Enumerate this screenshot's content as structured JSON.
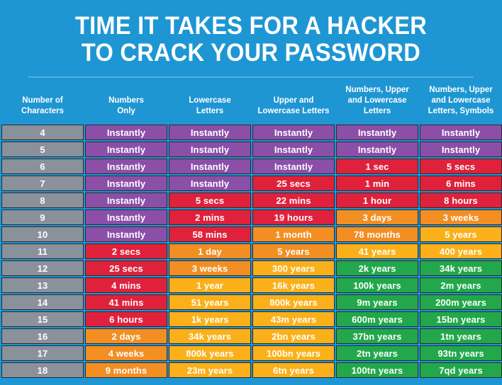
{
  "title": {
    "line1": "TIME IT TAKES FOR A HACKER",
    "line2": "TO CRACK YOUR PASSWORD"
  },
  "theme": {
    "background": "#1e96d3",
    "divider": "#53b0de",
    "text": "#ffffff",
    "gray": "#8a919b",
    "purple": "#8b4fa8",
    "red": "#e0213c",
    "orange": "#f28e22",
    "amber": "#fbb019",
    "green": "#22a84a",
    "cell_border": "#2b2b33"
  },
  "chart_data": {
    "type": "table",
    "title": "TIME IT TAKES FOR A HACKER TO CRACK YOUR PASSWORD",
    "xlabel": "",
    "ylabel": "",
    "columns": [
      "Number of Characters",
      "Numbers Only",
      "Lowercase Letters",
      "Upper and Lowercase Letters",
      "Numbers, Upper and Lowercase Letters",
      "Numbers, Upper and Lowercase Letters, Symbols"
    ],
    "column_lines": [
      [
        "Number of",
        "Characters"
      ],
      [
        "Numbers",
        "Only"
      ],
      [
        "Lowercase",
        "Letters"
      ],
      [
        "Upper and",
        "Lowercase Letters"
      ],
      [
        "Numbers, Upper",
        "and Lowercase",
        "Letters"
      ],
      [
        "Numbers, Upper",
        "and Lowercase",
        "Letters, Symbols"
      ]
    ],
    "rows": [
      {
        "chars": "4",
        "cells": [
          {
            "v": "Instantly",
            "color": "purple"
          },
          {
            "v": "Instantly",
            "color": "purple"
          },
          {
            "v": "Instantly",
            "color": "purple"
          },
          {
            "v": "Instantly",
            "color": "purple"
          },
          {
            "v": "Instantly",
            "color": "purple"
          }
        ]
      },
      {
        "chars": "5",
        "cells": [
          {
            "v": "Instantly",
            "color": "purple"
          },
          {
            "v": "Instantly",
            "color": "purple"
          },
          {
            "v": "Instantly",
            "color": "purple"
          },
          {
            "v": "Instantly",
            "color": "purple"
          },
          {
            "v": "Instantly",
            "color": "purple"
          }
        ]
      },
      {
        "chars": "6",
        "cells": [
          {
            "v": "Instantly",
            "color": "purple"
          },
          {
            "v": "Instantly",
            "color": "purple"
          },
          {
            "v": "Instantly",
            "color": "purple"
          },
          {
            "v": "1 sec",
            "color": "red"
          },
          {
            "v": "5 secs",
            "color": "red"
          }
        ]
      },
      {
        "chars": "7",
        "cells": [
          {
            "v": "Instantly",
            "color": "purple"
          },
          {
            "v": "Instantly",
            "color": "purple"
          },
          {
            "v": "25 secs",
            "color": "red"
          },
          {
            "v": "1 min",
            "color": "red"
          },
          {
            "v": "6 mins",
            "color": "red"
          }
        ]
      },
      {
        "chars": "8",
        "cells": [
          {
            "v": "Instantly",
            "color": "purple"
          },
          {
            "v": "5 secs",
            "color": "red"
          },
          {
            "v": "22 mins",
            "color": "red"
          },
          {
            "v": "1 hour",
            "color": "red"
          },
          {
            "v": "8 hours",
            "color": "red"
          }
        ]
      },
      {
        "chars": "9",
        "cells": [
          {
            "v": "Instantly",
            "color": "purple"
          },
          {
            "v": "2 mins",
            "color": "red"
          },
          {
            "v": "19 hours",
            "color": "red"
          },
          {
            "v": "3 days",
            "color": "orange"
          },
          {
            "v": "3 weeks",
            "color": "orange"
          }
        ]
      },
      {
        "chars": "10",
        "cells": [
          {
            "v": "Instantly",
            "color": "purple"
          },
          {
            "v": "58 mins",
            "color": "red"
          },
          {
            "v": "1 month",
            "color": "orange"
          },
          {
            "v": "78 months",
            "color": "orange"
          },
          {
            "v": "5 years",
            "color": "amber"
          }
        ]
      },
      {
        "chars": "11",
        "cells": [
          {
            "v": "2 secs",
            "color": "red"
          },
          {
            "v": "1 day",
            "color": "orange"
          },
          {
            "v": "5 years",
            "color": "orange"
          },
          {
            "v": "41 years",
            "color": "amber"
          },
          {
            "v": "400 years",
            "color": "amber"
          }
        ]
      },
      {
        "chars": "12",
        "cells": [
          {
            "v": "25 secs",
            "color": "red"
          },
          {
            "v": "3 weeks",
            "color": "orange"
          },
          {
            "v": "300 years",
            "color": "amber"
          },
          {
            "v": "2k years",
            "color": "green"
          },
          {
            "v": "34k years",
            "color": "green"
          }
        ]
      },
      {
        "chars": "13",
        "cells": [
          {
            "v": "4 mins",
            "color": "red"
          },
          {
            "v": "1 year",
            "color": "amber"
          },
          {
            "v": "16k years",
            "color": "amber"
          },
          {
            "v": "100k years",
            "color": "green"
          },
          {
            "v": "2m years",
            "color": "green"
          }
        ]
      },
      {
        "chars": "14",
        "cells": [
          {
            "v": "41 mins",
            "color": "red"
          },
          {
            "v": "51 years",
            "color": "amber"
          },
          {
            "v": "800k years",
            "color": "amber"
          },
          {
            "v": "9m years",
            "color": "green"
          },
          {
            "v": "200m years",
            "color": "green"
          }
        ]
      },
      {
        "chars": "15",
        "cells": [
          {
            "v": "6 hours",
            "color": "red"
          },
          {
            "v": "1k years",
            "color": "amber"
          },
          {
            "v": "43m years",
            "color": "amber"
          },
          {
            "v": "600m years",
            "color": "green"
          },
          {
            "v": "15bn years",
            "color": "green"
          }
        ]
      },
      {
        "chars": "16",
        "cells": [
          {
            "v": "2 days",
            "color": "orange"
          },
          {
            "v": "34k years",
            "color": "amber"
          },
          {
            "v": "2bn years",
            "color": "amber"
          },
          {
            "v": "37bn years",
            "color": "green"
          },
          {
            "v": "1tn years",
            "color": "green"
          }
        ]
      },
      {
        "chars": "17",
        "cells": [
          {
            "v": "4 weeks",
            "color": "orange"
          },
          {
            "v": "800k years",
            "color": "amber"
          },
          {
            "v": "100bn years",
            "color": "amber"
          },
          {
            "v": "2tn years",
            "color": "green"
          },
          {
            "v": "93tn years",
            "color": "green"
          }
        ]
      },
      {
        "chars": "18",
        "cells": [
          {
            "v": "9 months",
            "color": "orange"
          },
          {
            "v": "23m years",
            "color": "amber"
          },
          {
            "v": "6tn years",
            "color": "amber"
          },
          {
            "v": "100tn years",
            "color": "green"
          },
          {
            "v": "7qd years",
            "color": "green"
          }
        ]
      }
    ]
  }
}
